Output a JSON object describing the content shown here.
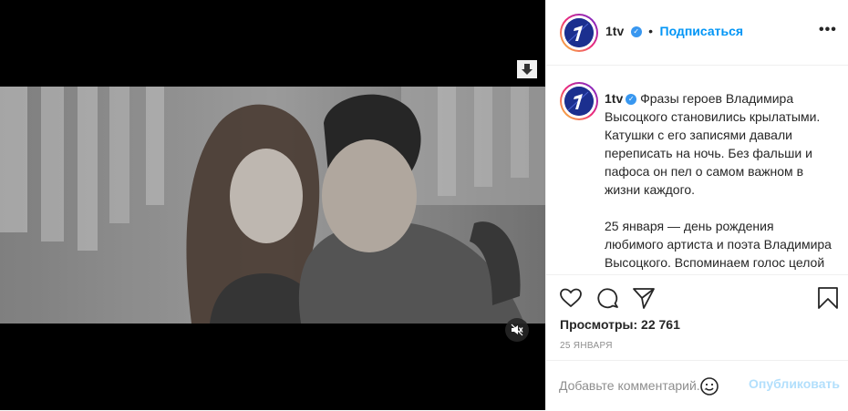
{
  "post": {
    "username": "1tv",
    "follow_label": "Подписаться",
    "more_label": "•••",
    "separator": "•",
    "caption_p1": "Фразы героев Владимира Высоцкого становились крылатыми. Катушки с его записями давали переписать на ночь. Без фальши и пафоса он пел о самом важном в жизни каждого.",
    "caption_p2": "25 января — день рождения любимого артиста и поэта Владимира Высоцкого. Вспоминаем голос целой эпохи на Первом ⬇️",
    "views_label": "Просмотры: 22 761",
    "date": "25 января"
  },
  "comment": {
    "placeholder": "Добавьте комментарий...",
    "publish_label": "Опубликовать"
  },
  "icons": {
    "download": "download-arrow-icon",
    "mute": "speaker-muted-icon",
    "like": "heart-icon",
    "comment": "speech-bubble-icon",
    "share": "paper-plane-icon",
    "save": "bookmark-icon",
    "emoji": "smiley-icon",
    "verified": "verified-badge-icon"
  },
  "colors": {
    "accent": "#0095f6",
    "verified": "#3897f0",
    "publish_disabled": "#b2dffc",
    "brand_logo": "#1b2f8f"
  }
}
